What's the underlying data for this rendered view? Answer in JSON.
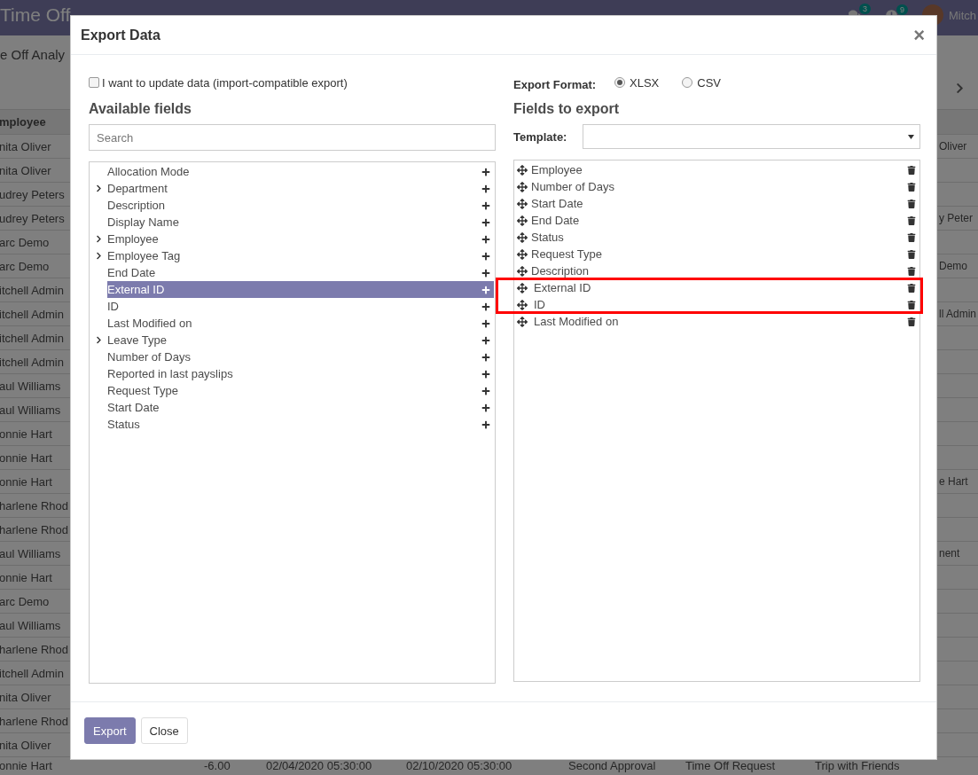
{
  "navbar": {
    "app_title": "Time Off",
    "messages_badge": "3",
    "activities_badge": "9",
    "user": "Mitch"
  },
  "control_panel": {
    "title": "e Off Analy"
  },
  "table": {
    "header": "mployee",
    "rows": [
      {
        "employee": "nita Oliver",
        "column_8": "Oliver"
      },
      {
        "employee": "nita Oliver"
      },
      {
        "employee": "udrey Peters"
      },
      {
        "employee": "udrey Peters",
        "column_8": "y Peter"
      },
      {
        "employee": "arc Demo"
      },
      {
        "employee": "arc Demo",
        "column_8": "Demo"
      },
      {
        "employee": "itchell Admin"
      },
      {
        "employee": "itchell Admin",
        "column_8": "ll Admin"
      },
      {
        "employee": "itchell Admin"
      },
      {
        "employee": "itchell Admin"
      },
      {
        "employee": "aul Williams"
      },
      {
        "employee": "aul Williams"
      },
      {
        "employee": "onnie Hart"
      },
      {
        "employee": "onnie Hart"
      },
      {
        "employee": "onnie Hart",
        "column_8": "e Hart"
      },
      {
        "employee": "harlene Rhod"
      },
      {
        "employee": "harlene Rhod"
      },
      {
        "employee": "aul Williams",
        "column_8": "nent"
      },
      {
        "employee": "onnie Hart"
      },
      {
        "employee": "arc Demo"
      },
      {
        "employee": "aul Williams"
      },
      {
        "employee": "harlene Rhod"
      },
      {
        "employee": "itchell Admin"
      },
      {
        "employee": "nita Oliver"
      },
      {
        "employee": "harlene Rhod"
      },
      {
        "employee": "nita Oliver"
      },
      {
        "employee": "onnie Hart",
        "days": "-6.00",
        "start_date": "02/04/2020 05:30:00",
        "end_date": "02/10/2020 05:30:00",
        "status": "Second Approval",
        "request_type": "Time Off Request",
        "description": "Trip with Friends"
      }
    ]
  },
  "dialog": {
    "title": "Export Data",
    "close": "×",
    "import_compatible": {
      "label": "I want to update data (import-compatible export)",
      "checked": false
    },
    "export_format": {
      "label": "Export Format:",
      "options": [
        {
          "label": "XLSX",
          "selected": true
        },
        {
          "label": "CSV",
          "selected": false
        }
      ]
    },
    "available_fields": {
      "heading": "Available fields",
      "search": {
        "placeholder": "Search"
      },
      "items": [
        {
          "label": "Allocation Mode",
          "expandable": false,
          "selected": false
        },
        {
          "label": "Department",
          "expandable": true,
          "selected": false
        },
        {
          "label": "Description",
          "expandable": false,
          "selected": false
        },
        {
          "label": "Display Name",
          "expandable": false,
          "selected": false
        },
        {
          "label": "Employee",
          "expandable": true,
          "selected": false
        },
        {
          "label": "Employee Tag",
          "expandable": true,
          "selected": false
        },
        {
          "label": "End Date",
          "expandable": false,
          "selected": false
        },
        {
          "label": "External ID",
          "expandable": false,
          "selected": true
        },
        {
          "label": "ID",
          "expandable": false,
          "selected": false
        },
        {
          "label": "Last Modified on",
          "expandable": false,
          "selected": false
        },
        {
          "label": "Leave Type",
          "expandable": true,
          "selected": false
        },
        {
          "label": "Number of Days",
          "expandable": false,
          "selected": false
        },
        {
          "label": "Reported in last payslips",
          "expandable": false,
          "selected": false
        },
        {
          "label": "Request Type",
          "expandable": false,
          "selected": false
        },
        {
          "label": "Start Date",
          "expandable": false,
          "selected": false
        },
        {
          "label": "Status",
          "expandable": false,
          "selected": false
        }
      ]
    },
    "fields_to_export": {
      "heading": "Fields to export",
      "template_label": "Template:",
      "groups": [
        {
          "highlighted": false,
          "items": [
            {
              "label": "Employee",
              "indented": false
            },
            {
              "label": "Number of Days",
              "indented": false
            },
            {
              "label": "Start Date",
              "indented": false
            },
            {
              "label": "End Date",
              "indented": false
            },
            {
              "label": "Status",
              "indented": false
            },
            {
              "label": "Request Type",
              "indented": false
            },
            {
              "label": "Description",
              "indented": false
            }
          ]
        },
        {
          "highlighted": true,
          "items": [
            {
              "label": "External ID",
              "indented": true
            },
            {
              "label": "ID",
              "indented": true
            }
          ]
        },
        {
          "highlighted": false,
          "items": [
            {
              "label": "Last Modified on",
              "indented": true
            }
          ]
        }
      ]
    },
    "buttons": [
      {
        "label": "Export",
        "kind": "primary"
      },
      {
        "label": "Close",
        "kind": "secondary"
      }
    ]
  }
}
